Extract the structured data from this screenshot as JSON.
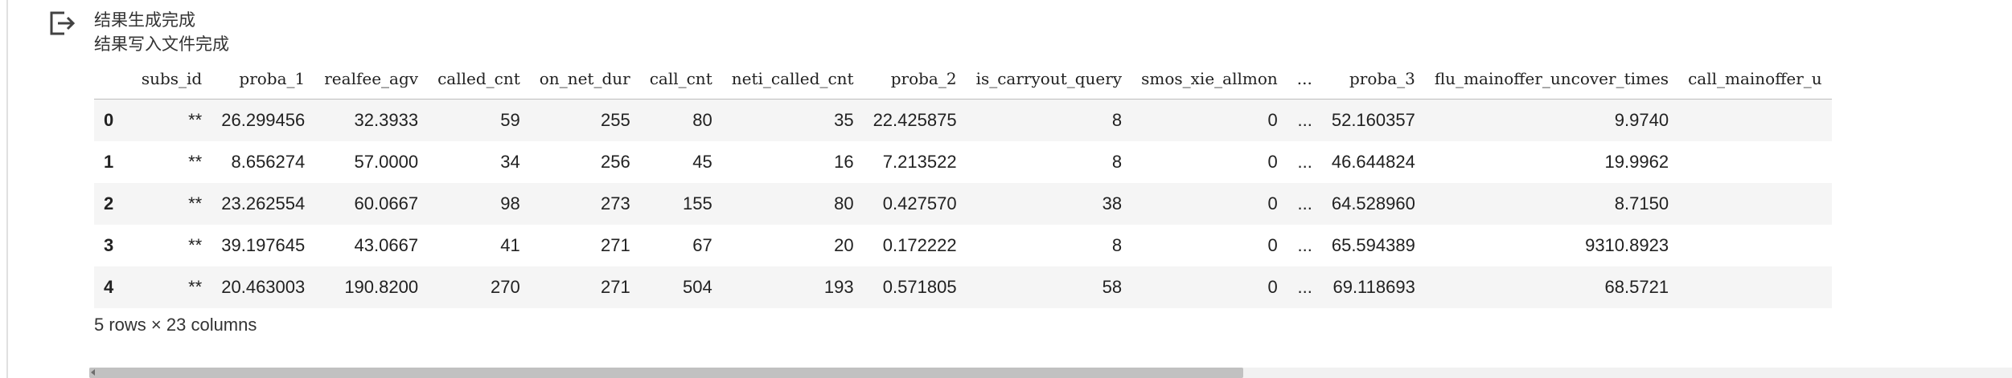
{
  "output": {
    "icon": "output-redirect-icon",
    "status_lines": [
      "结果生成完成",
      "结果写入文件完成"
    ]
  },
  "dataframe": {
    "columns": [
      "subs_id",
      "proba_1",
      "realfee_agv",
      "called_cnt",
      "on_net_dur",
      "call_cnt",
      "neti_called_cnt",
      "proba_2",
      "is_carryout_query",
      "smos_xie_allmon",
      "...",
      "proba_3",
      "flu_mainoffer_uncover_times",
      "call_mainoffer_u"
    ],
    "rows": [
      {
        "index": "0",
        "cells": [
          "**",
          "26.299456",
          "32.3933",
          "59",
          "255",
          "80",
          "35",
          "22.425875",
          "8",
          "0",
          "...",
          "52.160357",
          "9.9740",
          ""
        ]
      },
      {
        "index": "1",
        "cells": [
          "**",
          "8.656274",
          "57.0000",
          "34",
          "256",
          "45",
          "16",
          "7.213522",
          "8",
          "0",
          "...",
          "46.644824",
          "19.9962",
          ""
        ]
      },
      {
        "index": "2",
        "cells": [
          "**",
          "23.262554",
          "60.0667",
          "98",
          "273",
          "155",
          "80",
          "0.427570",
          "38",
          "0",
          "...",
          "64.528960",
          "8.7150",
          ""
        ]
      },
      {
        "index": "3",
        "cells": [
          "**",
          "39.197645",
          "43.0667",
          "41",
          "271",
          "67",
          "20",
          "0.172222",
          "8",
          "0",
          "...",
          "65.594389",
          "9310.8923",
          ""
        ]
      },
      {
        "index": "4",
        "cells": [
          "**",
          "20.463003",
          "190.8200",
          "270",
          "271",
          "504",
          "193",
          "0.571805",
          "58",
          "0",
          "...",
          "69.118693",
          "68.5721",
          ""
        ]
      }
    ],
    "shape_note": "5 rows × 23 columns"
  },
  "scrollbar": {
    "thumb_fraction": 0.6
  },
  "colors": {
    "stripe": "#f5f5f5",
    "scroll_track": "#f1f1f1",
    "scroll_thumb": "#c1c1c1"
  }
}
